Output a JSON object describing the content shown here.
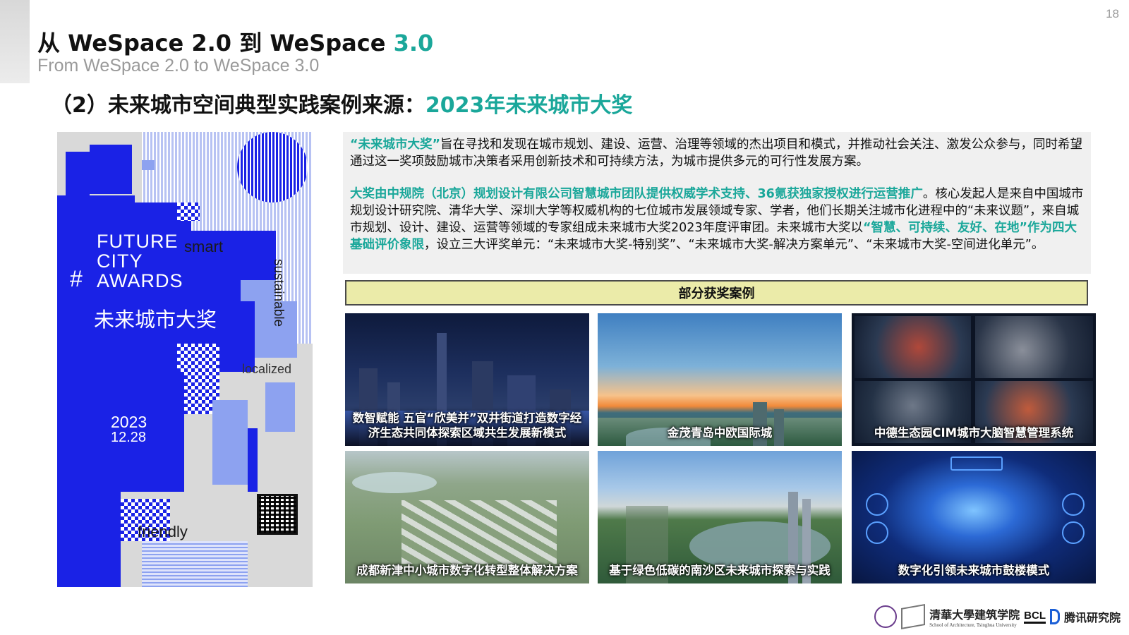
{
  "page": {
    "number": "18",
    "title_prefix": "从 WeSpace 2.0 到 WeSpace ",
    "title_accent": "3.0",
    "subtitle": "From WeSpace 2.0 to WeSpace 3.0",
    "heading_prefix": "（2）未来城市空间典型实践案例来源：",
    "heading_accent": "2023年未来城市大奖"
  },
  "poster": {
    "line1": "FUTURE",
    "line2": "CITY",
    "line3": "AWARDS",
    "hash": "#",
    "smart": "smart",
    "sustainable": "sustainable",
    "localized": "localized",
    "friendly": "friendly",
    "cn_title": "未来城市大奖",
    "year": "2023",
    "date": "12.28"
  },
  "info": {
    "p1_hl": "“未来城市大奖”",
    "p1_text": "旨在寻找和发现在城市规划、建设、运营、治理等领域的杰出项目和模式，并推动社会关注、激发公众参与，同时希望通过这一奖项鼓励城市决策者采用创新技术和可持续方法，为城市提供多元的可行性发展方案。",
    "p2_hl": "大奖由中规院（北京）规划设计有限公司智慧城市团队提供权威学术支持、36氪获独家授权进行运营推广",
    "p2_text_a": "。核心发起人是来自中国城市规划设计研究院、清华大学、深圳大学等权威机构的七位城市发展领域专家、学者，他们长期关注城市化进程中的“未来议题”，来自城市规划、设计、建设、运营等领域的专家组成未来城市大奖2023年度评审团。未来城市大奖以",
    "p2_hl2": "“智慧、可持续、友好、在地”作为四大基础评价象限",
    "p2_text_b": "，设立三大评奖单元：“未来城市大奖-特别奖”、“未来城市大奖-解决方案单元”、“未来城市大奖-空间进化单元”。"
  },
  "banner": "部分获奖案例",
  "cases": [
    {
      "caption": "数智赋能 五官“欣美并”双井街道打造数字经济生态共同体探索区域共生发展新模式"
    },
    {
      "caption": "金茂青岛中欧国际城"
    },
    {
      "caption": "中德生态园CIM城市大脑智慧管理系统"
    },
    {
      "caption": "成都新津中小城市数字化转型整体解决方案"
    },
    {
      "caption": "基于绿色低碳的南沙区未来城市探索与实践"
    },
    {
      "caption": "数字化引领未来城市鼓楼模式"
    }
  ],
  "logos": {
    "tsinghua": "清華大學建筑学院",
    "tsinghua_sub": "School of Architecture, Tsinghua University",
    "bcl": "BCL",
    "tencent": "腾讯研究院"
  },
  "colors": {
    "accent": "#1aa79a",
    "poster_blue": "#1a22e6",
    "banner_bg": "#ebeba9"
  }
}
